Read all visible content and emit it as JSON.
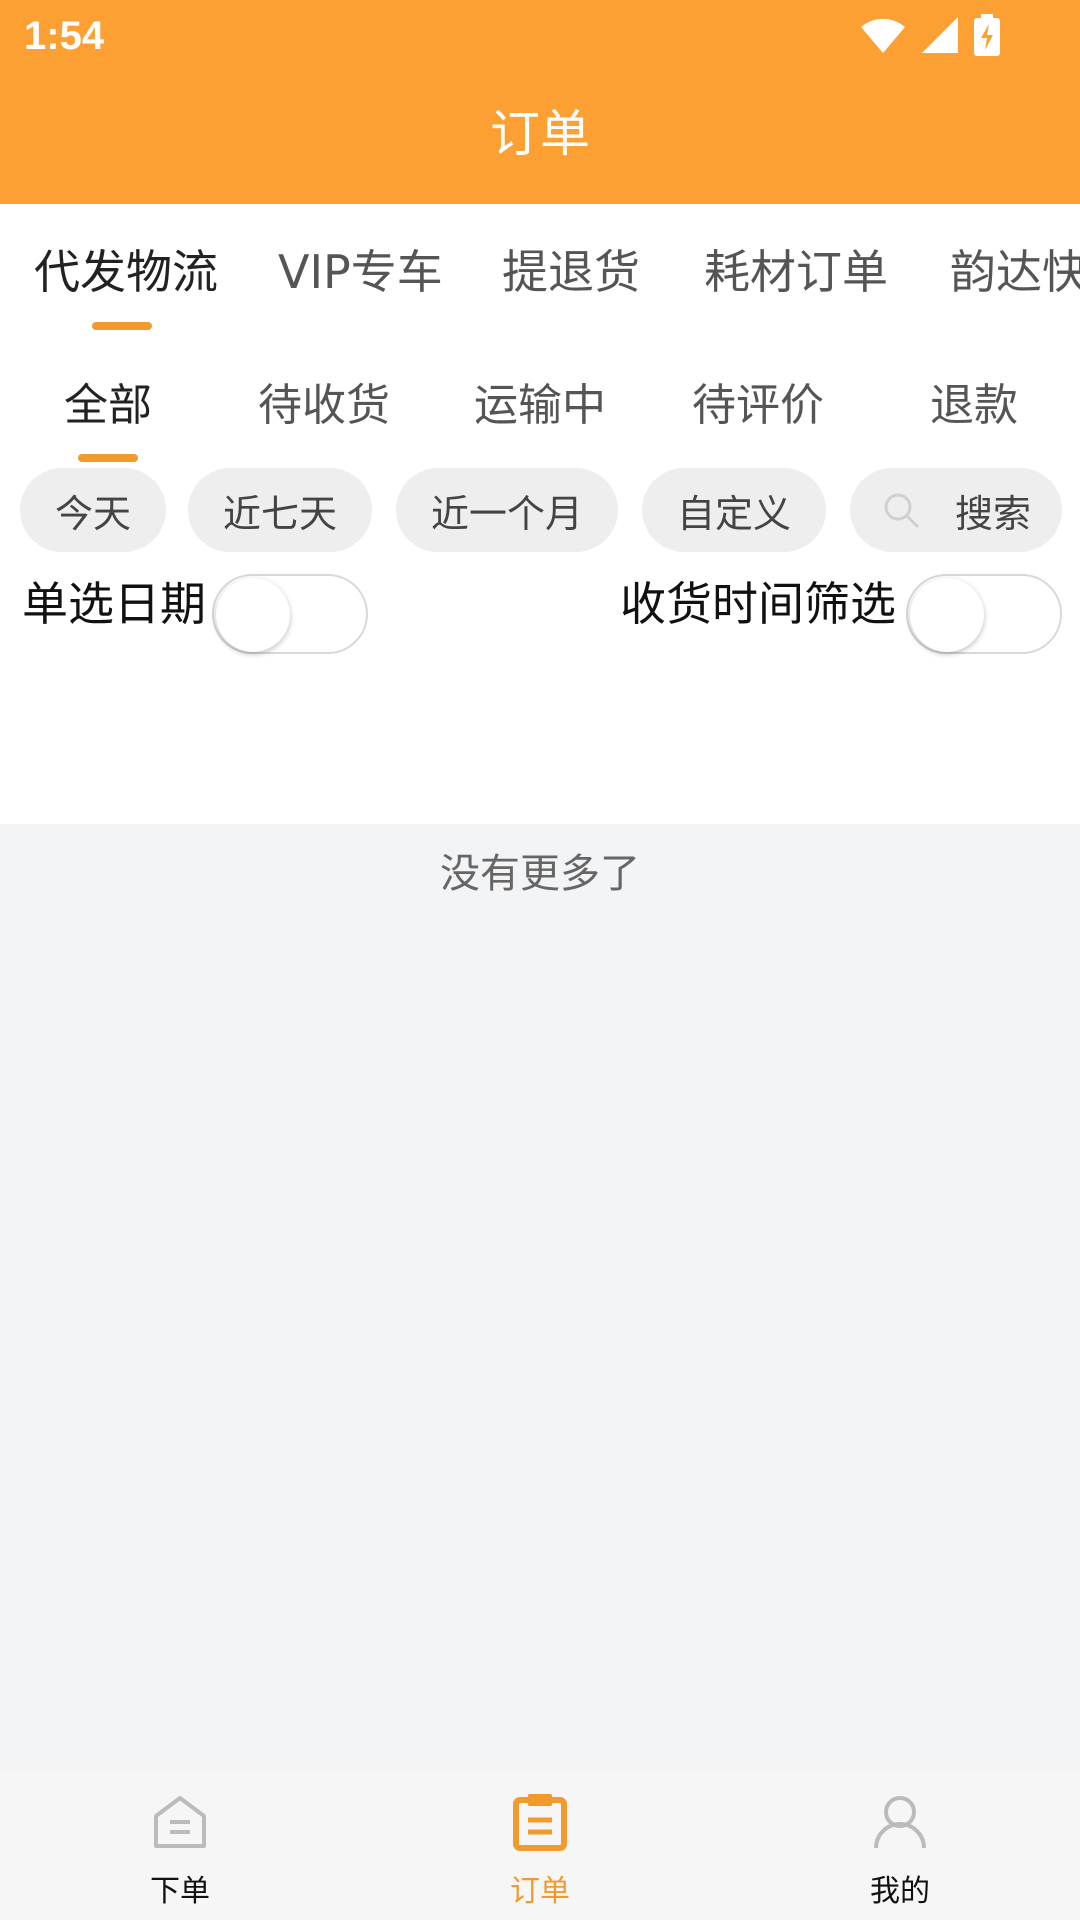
{
  "status_bar": {
    "time": "1:54"
  },
  "header": {
    "title": "订单"
  },
  "top_tabs": [
    {
      "label": "代发物流",
      "active": true
    },
    {
      "label": "VIP专车",
      "active": false
    },
    {
      "label": "提退货",
      "active": false
    },
    {
      "label": "耗材订单",
      "active": false
    },
    {
      "label": "韵达快",
      "active": false
    }
  ],
  "sub_tabs": [
    {
      "label": "全部",
      "active": true
    },
    {
      "label": "待收货",
      "active": false
    },
    {
      "label": "运输中",
      "active": false
    },
    {
      "label": "待评价",
      "active": false
    },
    {
      "label": "退款",
      "active": false
    }
  ],
  "date_chips": [
    "今天",
    "近七天",
    "近一个月",
    "自定义"
  ],
  "search": {
    "label": "搜索",
    "icon": "search-icon"
  },
  "filters": {
    "single_date": {
      "label": "单选日期",
      "on": false
    },
    "receive_time": {
      "label": "收货时间筛选",
      "on": false
    }
  },
  "list": {
    "empty_text": "没有更多了"
  },
  "bottom_nav": [
    {
      "label": "下单",
      "icon": "home-icon",
      "active": false
    },
    {
      "label": "订单",
      "icon": "clipboard-icon",
      "active": true
    },
    {
      "label": "我的",
      "icon": "user-icon",
      "active": false
    }
  ],
  "colors": {
    "accent": "#fca033",
    "indicator": "#f39a2c",
    "background": "#f3f4f6"
  }
}
